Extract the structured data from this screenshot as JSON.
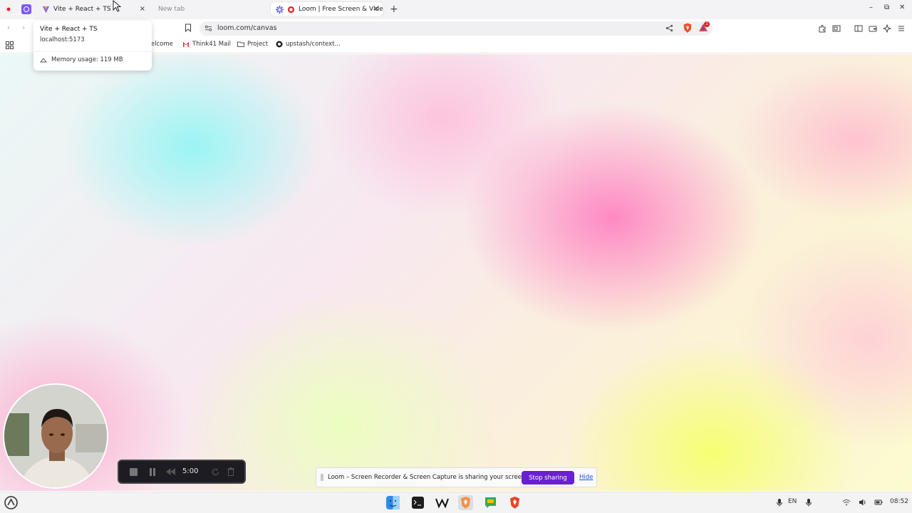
{
  "tabs": [
    {
      "label": "Vite + React + TS",
      "close": "×"
    },
    {
      "label": "New tab"
    },
    {
      "label": "Loom | Free Screen & Video Recording Software",
      "close": "×"
    }
  ],
  "new_tab_button": "+",
  "window_controls": {
    "minimize": "–",
    "maximize": "⧉",
    "close": "✕"
  },
  "nav": {
    "back": "‹",
    "forward": "›"
  },
  "address_bar": {
    "url": "loom.com/canvas"
  },
  "brave": {
    "rewards_badge": "1"
  },
  "bookmarks": [
    {
      "label": "Welcome"
    },
    {
      "label": "Think41 Mail"
    },
    {
      "label": "Project"
    },
    {
      "label": "upstash/context..."
    }
  ],
  "hover_card": {
    "title": "Vite + React + TS",
    "url": "localhost:5173",
    "memory": "Memory usage: 119 MB"
  },
  "loom_controls": {
    "timer": "5:00"
  },
  "sharing_bar": {
    "message": "Loom – Screen Recorder & Screen Capture is sharing your screen.",
    "stop_label": "Stop sharing",
    "hide_label": "Hide"
  },
  "taskbar": {
    "apps": [
      "finder-icon",
      "terminal-icon",
      "w-app-icon",
      "brave-browser-icon",
      "messages-app-icon",
      "brave-icon"
    ],
    "language": "EN",
    "clock": "08:52"
  },
  "colors": {
    "loom_purple": "#6a1fd1",
    "link_blue": "#1a56c9"
  }
}
